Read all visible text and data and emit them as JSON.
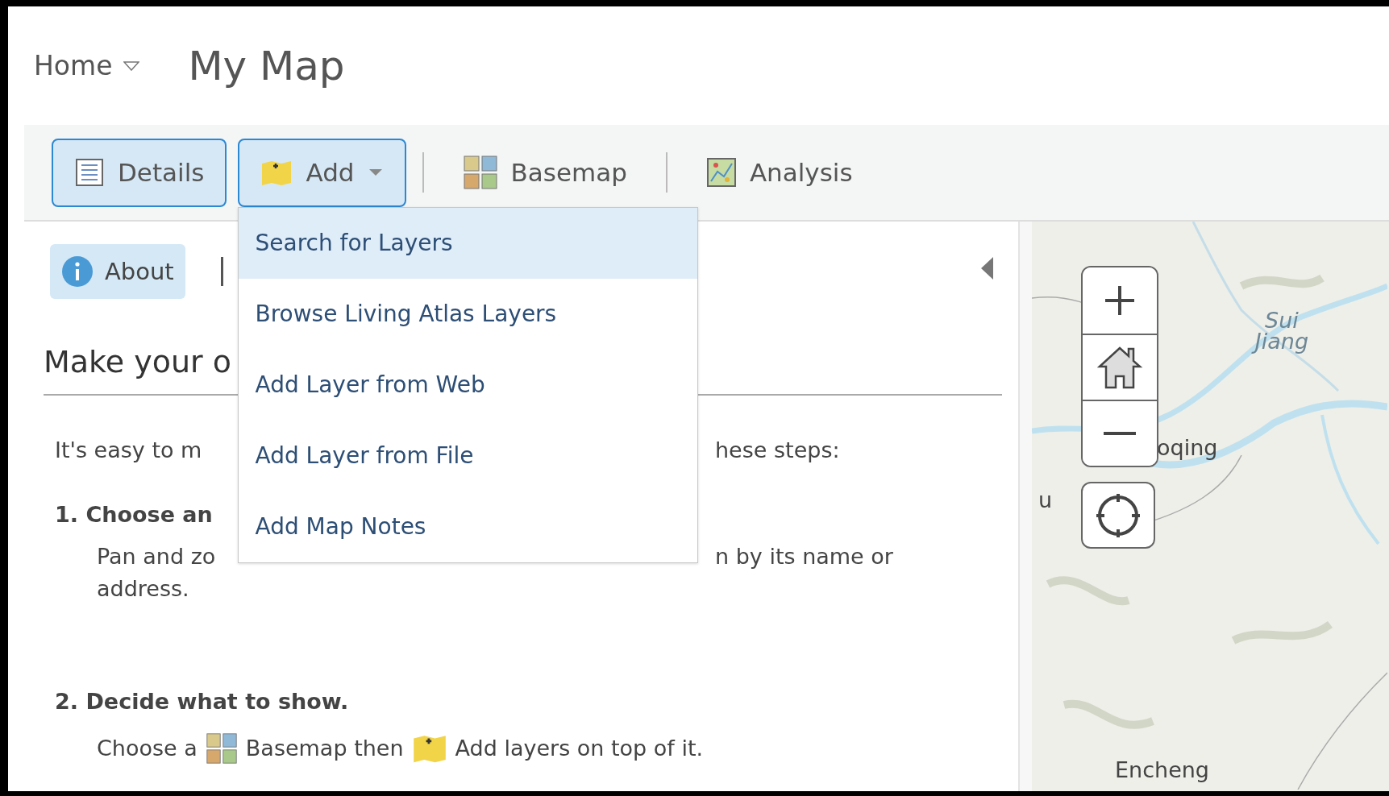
{
  "header": {
    "home": "Home",
    "title": "My Map"
  },
  "toolbar": [
    {
      "label": "Details",
      "kind": "details",
      "selected": true
    },
    {
      "label": "Add",
      "kind": "add",
      "selected": true,
      "expanded": true
    },
    {
      "label": "Basemap",
      "kind": "basemap",
      "selected": false
    },
    {
      "label": "Analysis",
      "kind": "analysis",
      "selected": false
    }
  ],
  "add_menu": [
    {
      "label": "Search for Layers",
      "selected": true
    },
    {
      "label": "Browse Living Atlas Layers",
      "selected": false
    },
    {
      "label": "Add Layer from Web",
      "selected": false
    },
    {
      "label": "Add Layer from File",
      "selected": false
    },
    {
      "label": "Add Map Notes",
      "selected": false
    }
  ],
  "panel": {
    "tabs": [
      {
        "label": "About",
        "selected": true
      }
    ],
    "heading": "Make your o",
    "intro": {
      "left": "It's easy to m",
      "right": "hese steps:"
    },
    "step_1": {
      "title": "1. Choose an",
      "lines": [
        {
          "left": "Pan and zo",
          "right": "n by its name or"
        },
        {
          "left": "address."
        }
      ]
    },
    "step_2": {
      "title": "2. Decide what to show.",
      "body": [
        {
          "kind": "text",
          "text": "Choose a"
        },
        {
          "kind": "basemap_icon"
        },
        {
          "kind": "text",
          "text": "Basemap then"
        },
        {
          "kind": "add_icon"
        },
        {
          "kind": "text",
          "text": "Add layers on top of it."
        }
      ]
    }
  },
  "map": {
    "labels": [
      {
        "text": "Sui Jiang",
        "kind": "water"
      },
      {
        "text": "oqing",
        "kind": "place"
      },
      {
        "text": "u",
        "kind": "place"
      },
      {
        "text": "Encheng",
        "kind": "place"
      }
    ]
  }
}
